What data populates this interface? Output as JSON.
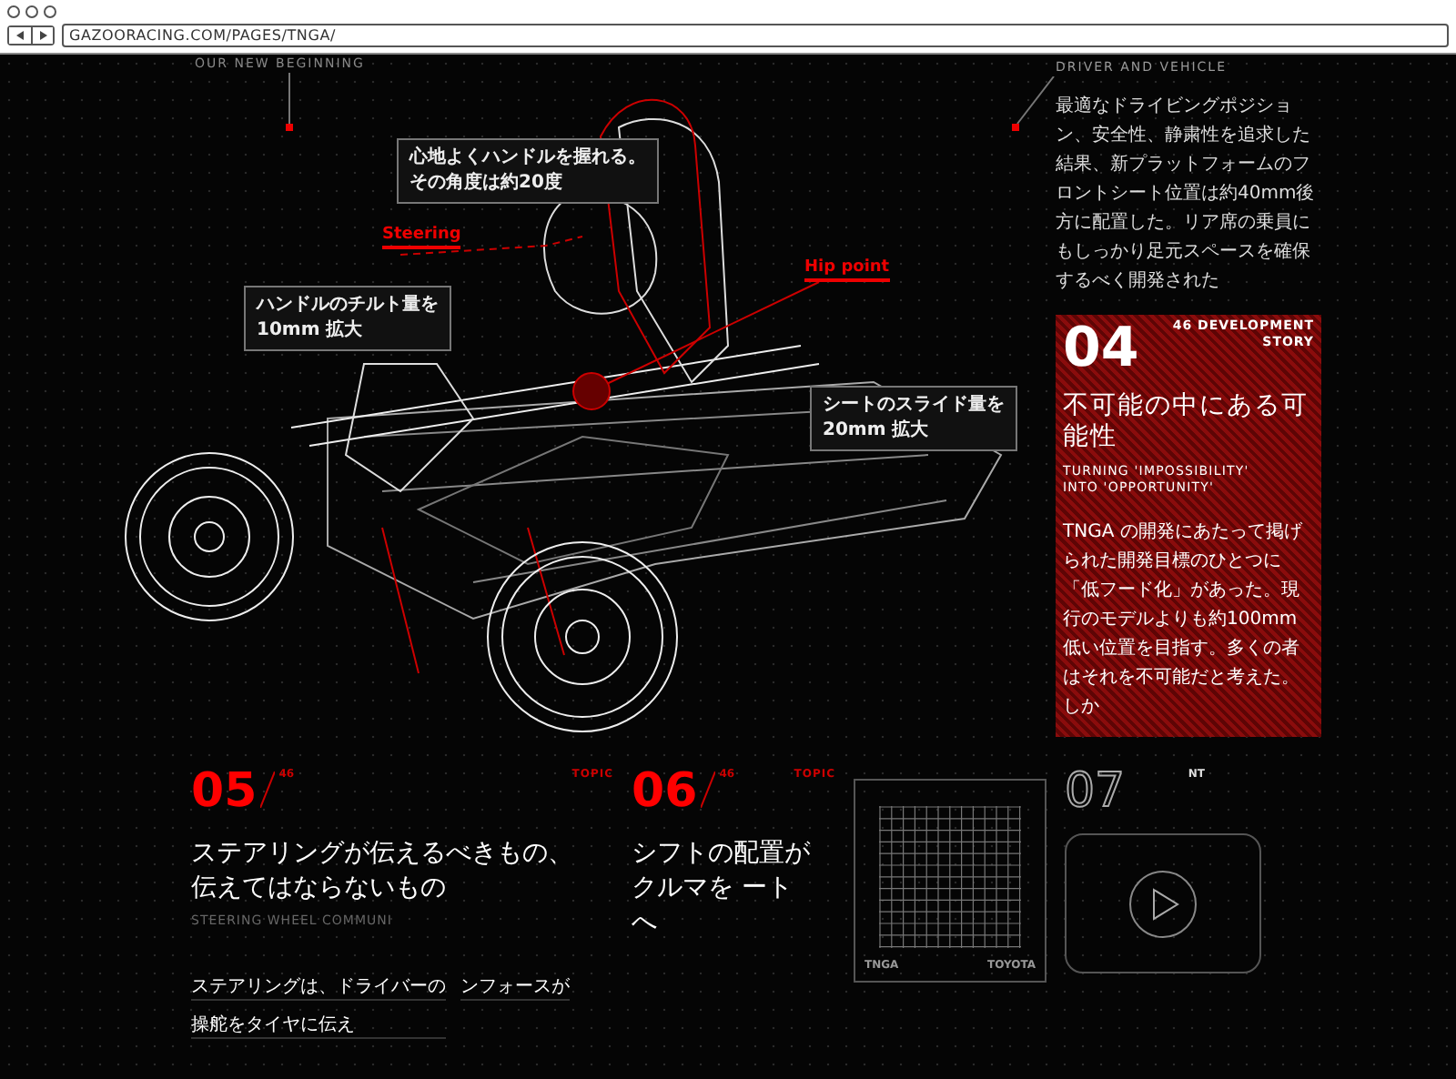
{
  "browser": {
    "url": "GAZOORACING.COM/PAGES/TNGA/"
  },
  "intro": {
    "label": "OUR NEW BEGINNING"
  },
  "callouts": [
    {
      "kind": "box",
      "lines": [
        "心地よくハンドルを握れる。",
        "その角度は約20度"
      ]
    },
    {
      "kind": "label",
      "lines": [
        "Steering"
      ]
    },
    {
      "kind": "box",
      "lines": [
        "ハンドルのチルト量を",
        "10mm 拡大"
      ]
    },
    {
      "kind": "label",
      "lines": [
        "Hip point"
      ]
    },
    {
      "kind": "box",
      "lines": [
        "シートのスライド量を",
        "20mm 拡大"
      ]
    }
  ],
  "driver": {
    "heading": "DRIVER AND VEHICLE",
    "body": "最適なドライビングポジション、安全性、静粛性を追求した結果、新プラットフォームのフロントシート位置は約40mm後方に配置した。リア席の乗員にもしっかり足元スペースを確保するべく開発された"
  },
  "story": {
    "number": "04",
    "tag_lines": [
      "46 DEVELOPMENT",
      "STORY"
    ],
    "title": "不可能の中にある可能性",
    "subtitle_lines": [
      "TURNING 'IMPOSSIBILITY'",
      "INTO 'OPPORTUNITY'"
    ],
    "body": "TNGA の開発にあたって掲げられた開発目標のひとつに「低フード化」があった。現行のモデルよりも約100mm低い位置を目指す。多くの者はそれを不可能だと考えた。しか"
  },
  "topics": [
    {
      "number": "05",
      "sup": "46",
      "tag": "TOPIC",
      "title_lines": [
        "ステアリングが伝えるべきもの、",
        "伝えてはならないもの"
      ],
      "subtitle": "STEERING WHEEL COMMUNI",
      "body_columns": [
        [
          "ステアリングは、ドライバーの",
          "操舵をタイヤに伝え"
        ],
        [
          "ンフォースが"
        ]
      ]
    },
    {
      "number": "06",
      "sup": "46",
      "tag": "TOPIC",
      "title_lines": [
        "シフトの配置が",
        "クルマを ート",
        "へ"
      ]
    }
  ],
  "diagram": {
    "left_label": "TNGA",
    "right_label": "TOYOTA"
  },
  "video_topic": {
    "number": "07",
    "tag": "NT"
  }
}
